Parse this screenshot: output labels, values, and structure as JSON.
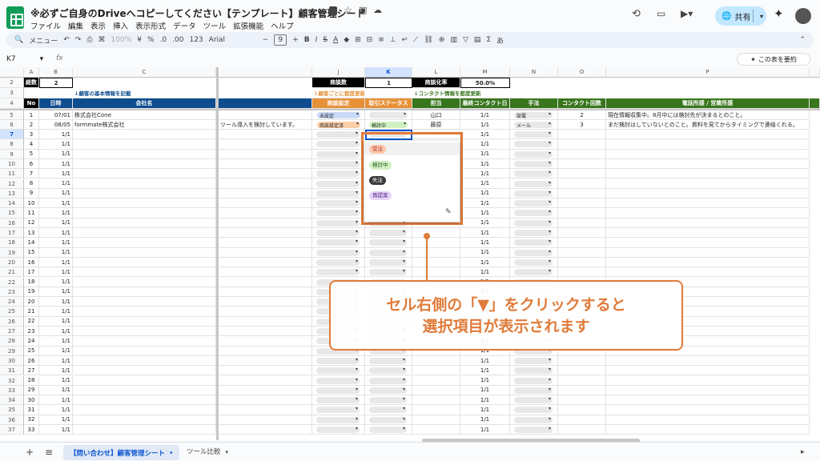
{
  "app": {
    "title": "※必ずご自身のDriveへコピーしてください【テンプレート】顧客管理シート",
    "menus": [
      "ファイル",
      "編集",
      "表示",
      "挿入",
      "表示形式",
      "データ",
      "ツール",
      "拡張機能",
      "ヘルプ"
    ],
    "share_label": "共有"
  },
  "toolbar": {
    "search": "メニュー",
    "zoom": "100%",
    "currency": "¥",
    "percent": "%",
    "dec_down": ".0",
    "dec_up": ".00",
    "num_fmt": "123",
    "font": "Arial",
    "font_size": "9"
  },
  "formula": {
    "cell_ref": "K7",
    "fx": "fx",
    "summarize": "この表を要約"
  },
  "columns": [
    "A",
    "B",
    "C",
    "J",
    "K",
    "L",
    "M",
    "N",
    "O",
    "P"
  ],
  "summary": {
    "total_label": "総数",
    "total_value": "2",
    "deals_label": "商談数",
    "deals_value": "1",
    "rate_label": "商談化率",
    "rate_value": "50.0%"
  },
  "sections": {
    "basic": "↓顧客の基本情報を記載",
    "deal": "↓顧客ごとに都度更新",
    "contact": "↓コンタクト情報を都度更新"
  },
  "headers": {
    "no": "No",
    "date": "日時",
    "company": "会社名",
    "deal_setting": "商談設定",
    "status": "取引ステータス",
    "owner": "担当",
    "last_contact": "最終コンタクト日",
    "method": "手法",
    "contact_count": "コンタクト回数",
    "notes": "電話所感 / 営業所感"
  },
  "rows": [
    {
      "row": "5",
      "no": "1",
      "date": "07/01",
      "company": "株式会社Cone",
      "memo": "",
      "deal": "未設定",
      "status": "",
      "owner": "山口",
      "last": "1/1",
      "method": "架電",
      "count": "2",
      "notes": "現在情報収集中。8月中には検討先が決まるとのこと。"
    },
    {
      "row": "6",
      "no": "2",
      "date": "08/05",
      "company": "formmate株式会社",
      "memo": "ツール導入を検討しています。",
      "deal": "商談設定済",
      "status": "検討中",
      "owner": "藤原",
      "last": "1/1",
      "method": "メール",
      "count": "3",
      "notes": "まだ検討はしていないとのこと。資料を見てからタイミングで連絡くれる。"
    }
  ],
  "empty_rows": [
    "7",
    "8",
    "9",
    "10",
    "11",
    "12",
    "13",
    "14",
    "15",
    "16",
    "17",
    "18",
    "19",
    "20",
    "21",
    "22",
    "23",
    "24",
    "25",
    "26",
    "27",
    "28",
    "29",
    "30",
    "31",
    "32",
    "33",
    "34",
    "35",
    "36",
    "37"
  ],
  "empty_date": "1/1",
  "dropdown": {
    "options": [
      "受注",
      "検討中",
      "失注",
      "再提案"
    ]
  },
  "callout": {
    "line1": "セル右側の「▼」をクリックすると",
    "line2": "選択項目が表示されます"
  },
  "sheets": {
    "active": "【問い合わせ】顧客管理シート",
    "other": "ツール比較"
  },
  "colors": {
    "header_blue": "#0d4c8e",
    "header_orange": "#e69138",
    "header_green": "#38761d",
    "accent": "#e07b39"
  }
}
